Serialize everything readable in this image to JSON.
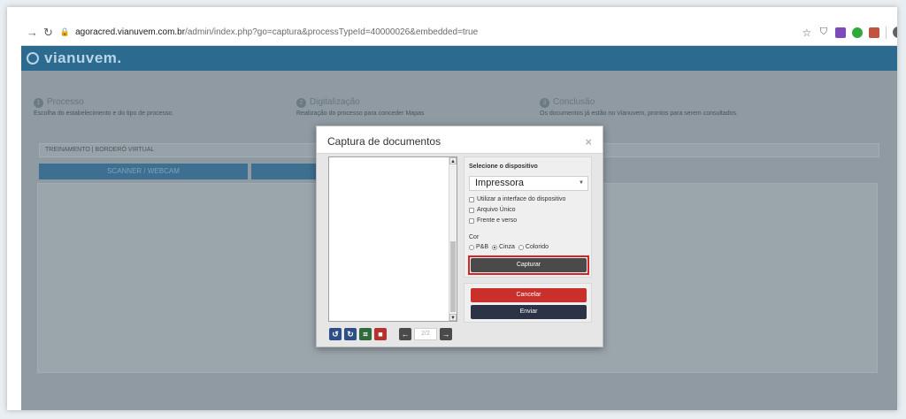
{
  "browser": {
    "url_domain": "agoracred.vianuvem.com.br",
    "url_path": "/admin/index.php?go=captura&processTypeId=40000026&embedded=true"
  },
  "app": {
    "logo": "vianuvem.",
    "steps": [
      {
        "num": "1",
        "title": "Processo",
        "desc": "Escolha do estabelecimento e do tipo de processo."
      },
      {
        "num": "2",
        "title": "Digitalização",
        "desc": "Realização do processo para conceder Mapas"
      },
      {
        "num": "3",
        "title": "Conclusão",
        "desc": "Os documentos já estão no Vianuvem, prontos para serem consultados."
      }
    ],
    "section_label": "TREINAMENTO | BORDERÔ VIRTUAL",
    "tab_scanner": "SCANNER / WEBCAM",
    "tab_second": ""
  },
  "modal": {
    "title": "Captura de documentos",
    "close": "×",
    "device_heading": "Selecione o dispositivo",
    "device_selected": "Impressora",
    "options": [
      "Utilizar a interface do dispositivo",
      "Arquivo Único",
      "Frente e verso"
    ],
    "color_label": "Cor",
    "color_options": [
      "P&B",
      "Cinza",
      "Colorido"
    ],
    "color_selected": "Cinza",
    "capture_label": "Capturar",
    "cancel_label": "Cancelar",
    "send_label": "Enviar",
    "page_indicator": "2/2"
  },
  "colors": {
    "accent_red": "#c9302c",
    "send_dark": "#2d3347",
    "header_blue": "#2c6a8f"
  }
}
